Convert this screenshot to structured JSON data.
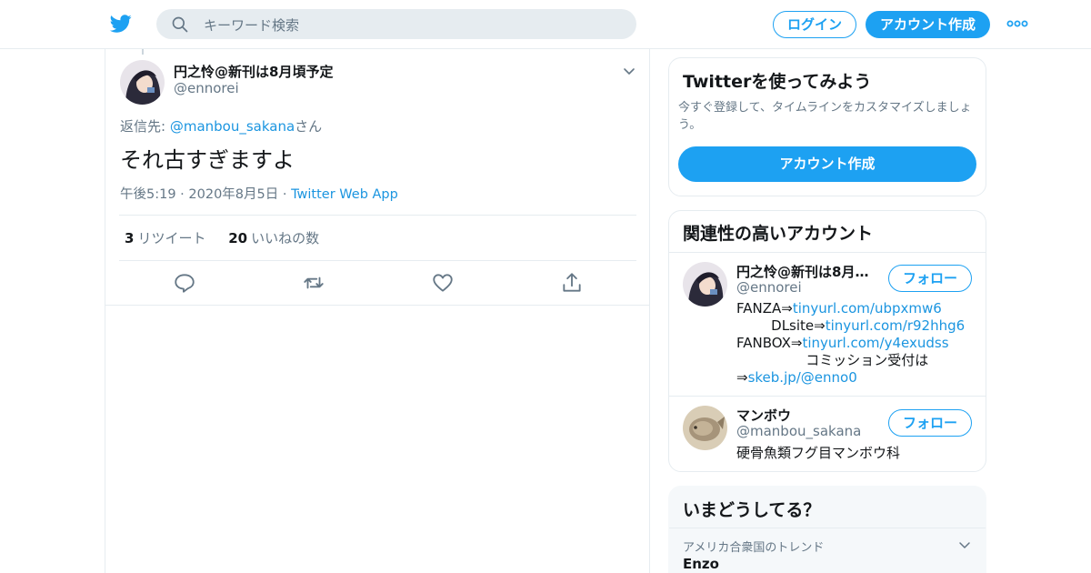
{
  "topbar": {
    "search_placeholder": "キーワード検索",
    "login_label": "ログイン",
    "signup_label": "アカウント作成"
  },
  "tweet": {
    "author_name": "円之怜@新刊は8月頃予定",
    "author_handle": "@ennorei",
    "reply_prefix": "返信先: ",
    "reply_target": "@manbou_sakana",
    "reply_suffix": "さん",
    "text": "それ古すぎますよ",
    "time": "午後5:19",
    "date": "2020年8月5日",
    "source": "Twitter Web App",
    "retweets_count": "3",
    "retweets_label": "リツイート",
    "likes_count": "20",
    "likes_label": "いいねの数"
  },
  "signup_card": {
    "title": "Twitterを使ってみよう",
    "description": "今すぐ登録して、タイムラインをカスタマイズしましょう。",
    "button_label": "アカウント作成"
  },
  "related": {
    "title": "関連性の高いアカウント",
    "follow_label": "フォロー",
    "accounts": [
      {
        "name": "円之怜@新刊は8月頃予定",
        "handle": "@ennorei",
        "bio": {
          "l1_text": "FANZA⇒",
          "l1_link": "tinyurl.com/ubpxmw6",
          "l2_text": "        DLsite⇒",
          "l2_link": "tinyurl.com/r92hhg6",
          "l3_text": "FANBOX⇒",
          "l3_link": "tinyurl.com/y4exudss",
          "l4_text": "                コミッション受付は",
          "l5_text": "⇒",
          "l5_link": "skeb.jp/@enno0"
        }
      },
      {
        "name": "マンボウ",
        "handle": "@manbou_sakana",
        "bio": "硬骨魚類フグ目マンボウ科"
      }
    ]
  },
  "trends": {
    "title": "いまどうしてる？",
    "location": "アメリカ合衆国のトレンド",
    "first_trend": "Enzo"
  },
  "colors": {
    "accent": "#1da1f2",
    "link": "#1b95e0",
    "muted": "#657786",
    "border": "#e6ecf0"
  }
}
